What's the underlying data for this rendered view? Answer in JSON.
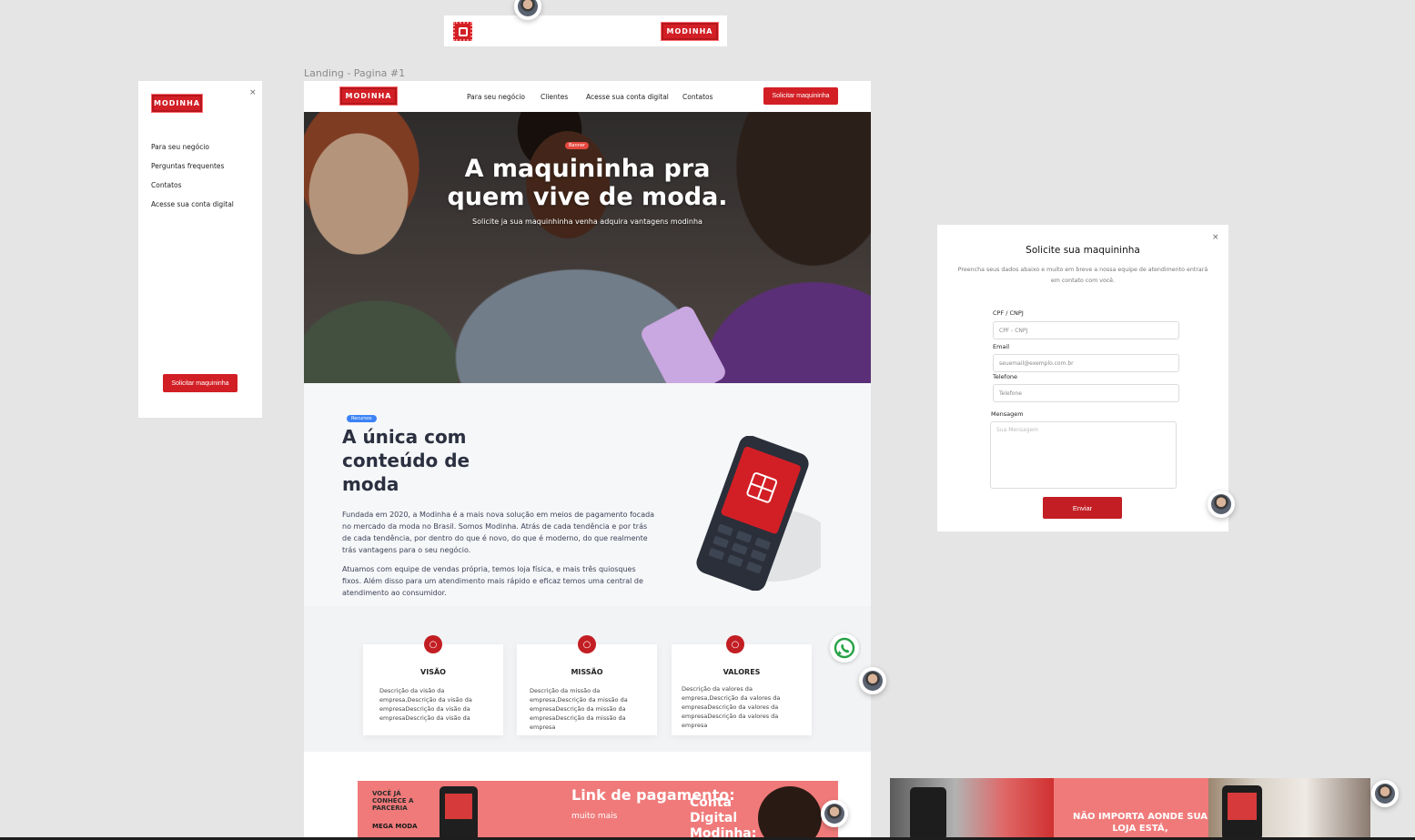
{
  "brand": {
    "name": "MODINHA",
    "accent": "#d21f25"
  },
  "frame_label": "Landing - Pagina #1",
  "mobile_menu": {
    "close": "×",
    "items": [
      "Para seu negócio",
      "Perguntas frequentes",
      "Contatos",
      "Acesse sua conta digital"
    ],
    "cta": "Solicitar maquininha"
  },
  "nav": {
    "links": [
      "Para seu negócio",
      "Clientes",
      "Acesse sua conta digital",
      "Contatos"
    ],
    "cta": "Solicitar maquininha"
  },
  "hero": {
    "badge": "Banner",
    "title_line1": "A maquininha pra",
    "title_line2": "quem vive de moda.",
    "subtitle": "Solicite ja sua maquinhinha venha adquira vantagens modinha"
  },
  "feature": {
    "tag": "Recursos",
    "title": "A única com conteúdo de moda",
    "paragraph1": "Fundada em 2020, a Modinha é a mais nova solução em meios de pagamento focada no mercado da moda no Brasil. Somos Modinha. Atrás de cada tendência e por trás de cada tendência, por dentro do que é novo, do que é moderno, do que realmente trás vantagens para o seu negócio.",
    "paragraph2": "Atuamos com equipe de vendas própria, temos loja física, e mais três quiosques fixos. Além disso para um atendimento mais rápido e eficaz temos uma central de atendimento ao consumidor."
  },
  "cards": [
    {
      "title": "VISÃO",
      "text": "Descrição da visão da empresa,Descrição da visão da empresaDescrição da visão da empresaDescrição da visão da"
    },
    {
      "title": "MISSÃO",
      "text": "Descrição da missão da empresa,Descrição da missão da empresaDescrição da missão da empresaDescrição da missão da empresa"
    },
    {
      "title": "VALORES",
      "text": "Descrição da valores da empresa,Descrição da valores da empresaDescrição da valores da empresaDescrição da valores da empresa"
    }
  ],
  "promo": {
    "left_text": "VOCÊ JÁ CONHECE A PARCERIA",
    "partner": "MEGA MODA",
    "middle_title": "Link de pagamento:",
    "middle_sub": "muito mais",
    "right_title": "Conta Digital Modinha:"
  },
  "form": {
    "close": "×",
    "title": "Solicite sua maquininha",
    "intro": "Preencha seus dados abaixo e muito em breve a nossa equipe de atendimento entrará em contato com você.",
    "fields": [
      {
        "label": "CPF / CNPJ",
        "placeholder": "CPF - CNPJ"
      },
      {
        "label": "Email",
        "placeholder": "seuemail@exemplo.com.br"
      },
      {
        "label": "Telefone",
        "placeholder": "Telefone"
      },
      {
        "label": "Mensagem",
        "placeholder": "Sua Mensagem"
      }
    ],
    "submit": "Enviar"
  },
  "bottom_banner": {
    "text": "NÃO IMPORTA AONDE SUA LOJA ESTÁ,"
  },
  "icons": {
    "whatsapp": "whatsapp-icon",
    "card_icon": "lightbulb-icon",
    "avatar": "user-avatar"
  }
}
